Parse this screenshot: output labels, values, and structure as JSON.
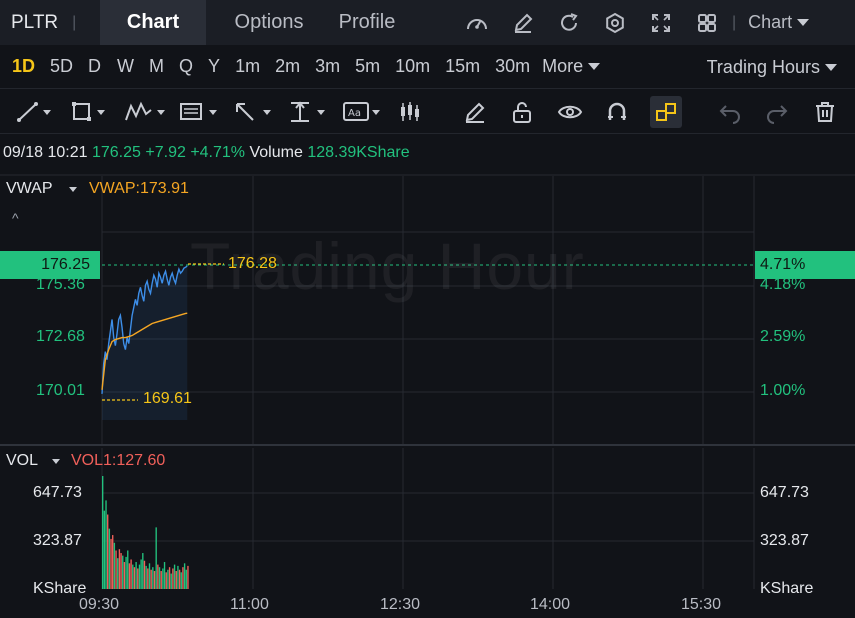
{
  "topbar": {
    "ticker": "PLTR",
    "tabs": [
      {
        "label": "Chart",
        "active": true
      },
      {
        "label": "Options",
        "active": false
      },
      {
        "label": "Profile",
        "active": false
      }
    ],
    "icons": [
      "gauge-icon",
      "edit-icon",
      "refresh-icon",
      "settings-icon",
      "fullscreen-icon",
      "grid-icon"
    ],
    "chart_dropdown": "Chart"
  },
  "periods": {
    "items": [
      "1D",
      "5D",
      "D",
      "W",
      "M",
      "Q",
      "Y",
      "1m",
      "2m",
      "3m",
      "5m",
      "10m",
      "15m",
      "30m"
    ],
    "active": "1D",
    "more": "More",
    "session": "Trading Hours"
  },
  "toolbar": {
    "icons": [
      "trend-line-icon",
      "rectangle-icon",
      "pattern-icon",
      "fibonacci-icon",
      "arrow-icon",
      "measure-icon",
      "text-icon",
      "candles-icon",
      "pencil-icon",
      "unlock-icon",
      "eye-icon",
      "magnet-icon",
      "link-icon",
      "undo-icon",
      "redo-icon",
      "trash-icon"
    ]
  },
  "info": {
    "datetime": "09/18 10:21",
    "price": "176.25",
    "change": "+7.92",
    "change_pct": "+4.71%",
    "volume_label": "Volume",
    "volume": "128.39KShare"
  },
  "main_panel": {
    "indicator": "VWAP",
    "indicator_value": "VWAP:173.91",
    "watermark": "Trading Hour",
    "current_price": "176.25",
    "current_pct": "4.71%",
    "high_marker": "176.28",
    "low_marker": "169.61",
    "left_ticks": [
      "175.36",
      "172.68",
      "170.01"
    ],
    "right_ticks": [
      "4.18%",
      "2.59%",
      "1.00%"
    ]
  },
  "volume_panel": {
    "indicator": "VOL",
    "indicator_value": "VOL1:127.60",
    "left_ticks": [
      "647.73",
      "323.87",
      "KShare"
    ],
    "right_ticks": [
      "647.73",
      "323.87",
      "KShare"
    ]
  },
  "x_axis": [
    "09:30",
    "11:00",
    "12:30",
    "14:00",
    "15:30"
  ],
  "colors": {
    "up": "#22c17e",
    "down": "#f0605a",
    "price_line": "#3d8ee8",
    "vwap_line": "#f5a623",
    "accent": "#f5c518"
  },
  "chart_data": {
    "type": "line",
    "session_start": "09:30",
    "session_end": "16:00",
    "ylim": [
      168.6,
      177.7
    ],
    "price": {
      "minutes": [
        0,
        1,
        2,
        3,
        4,
        5,
        6,
        7,
        8,
        9,
        10,
        11,
        12,
        13,
        14,
        15,
        16,
        17,
        18,
        19,
        20,
        21,
        22,
        23,
        24,
        25,
        26,
        27,
        28,
        29,
        30,
        31,
        32,
        33,
        34,
        35,
        36,
        37,
        38,
        39,
        40,
        41,
        42,
        43,
        44,
        45,
        46,
        47,
        48,
        49,
        50,
        51
      ],
      "values": [
        169.9,
        171.4,
        172.0,
        171.6,
        172.4,
        173.0,
        173.6,
        172.7,
        172.3,
        172.9,
        173.6,
        173.8,
        173.2,
        172.4,
        172.1,
        172.7,
        172.4,
        173.1,
        173.8,
        174.2,
        174.6,
        174.3,
        174.9,
        175.2,
        174.8,
        174.5,
        175.3,
        175.5,
        175.1,
        174.9,
        175.4,
        175.8,
        175.6,
        175.2,
        175.9,
        175.7,
        175.4,
        175.8,
        176.0,
        175.6,
        175.3,
        175.7,
        175.9,
        175.6,
        175.4,
        175.8,
        176.1,
        175.9,
        176.0,
        176.15,
        176.2,
        176.25
      ]
    },
    "vwap": {
      "minutes": [
        0,
        2,
        4,
        6,
        8,
        10,
        12,
        14,
        16,
        18,
        20,
        22,
        24,
        26,
        28,
        30,
        32,
        34,
        36,
        38,
        40,
        42,
        44,
        46,
        48,
        50,
        51
      ],
      "values": [
        170.1,
        171.6,
        172.1,
        172.5,
        172.6,
        172.65,
        172.7,
        172.7,
        172.75,
        172.8,
        172.9,
        173.0,
        173.1,
        173.2,
        173.3,
        173.4,
        173.45,
        173.5,
        173.55,
        173.6,
        173.65,
        173.7,
        173.75,
        173.8,
        173.85,
        173.9,
        173.91
      ]
    },
    "volume": {
      "ylim": [
        0,
        880
      ],
      "values": [
        880,
        610,
        690,
        580,
        470,
        390,
        420,
        360,
        300,
        240,
        310,
        280,
        260,
        210,
        250,
        300,
        200,
        230,
        190,
        170,
        210,
        160,
        190,
        230,
        280,
        220,
        180,
        160,
        200,
        150,
        170,
        140,
        480,
        190,
        170,
        140,
        160,
        210,
        130,
        150,
        170,
        120,
        160,
        190,
        140,
        180,
        150,
        130,
        170,
        200,
        150,
        180
      ],
      "direction": [
        "up",
        "up",
        "up",
        "down",
        "up",
        "down",
        "down",
        "up",
        "down",
        "up",
        "down",
        "down",
        "up",
        "down",
        "up",
        "up",
        "down",
        "down",
        "up",
        "down",
        "up",
        "down",
        "up",
        "up",
        "up",
        "down",
        "up",
        "down",
        "up",
        "down",
        "up",
        "down",
        "up",
        "down",
        "up",
        "down",
        "up",
        "up",
        "down",
        "up",
        "down",
        "up",
        "down",
        "up",
        "down",
        "up",
        "down",
        "up",
        "down",
        "up",
        "up",
        "down"
      ]
    }
  }
}
